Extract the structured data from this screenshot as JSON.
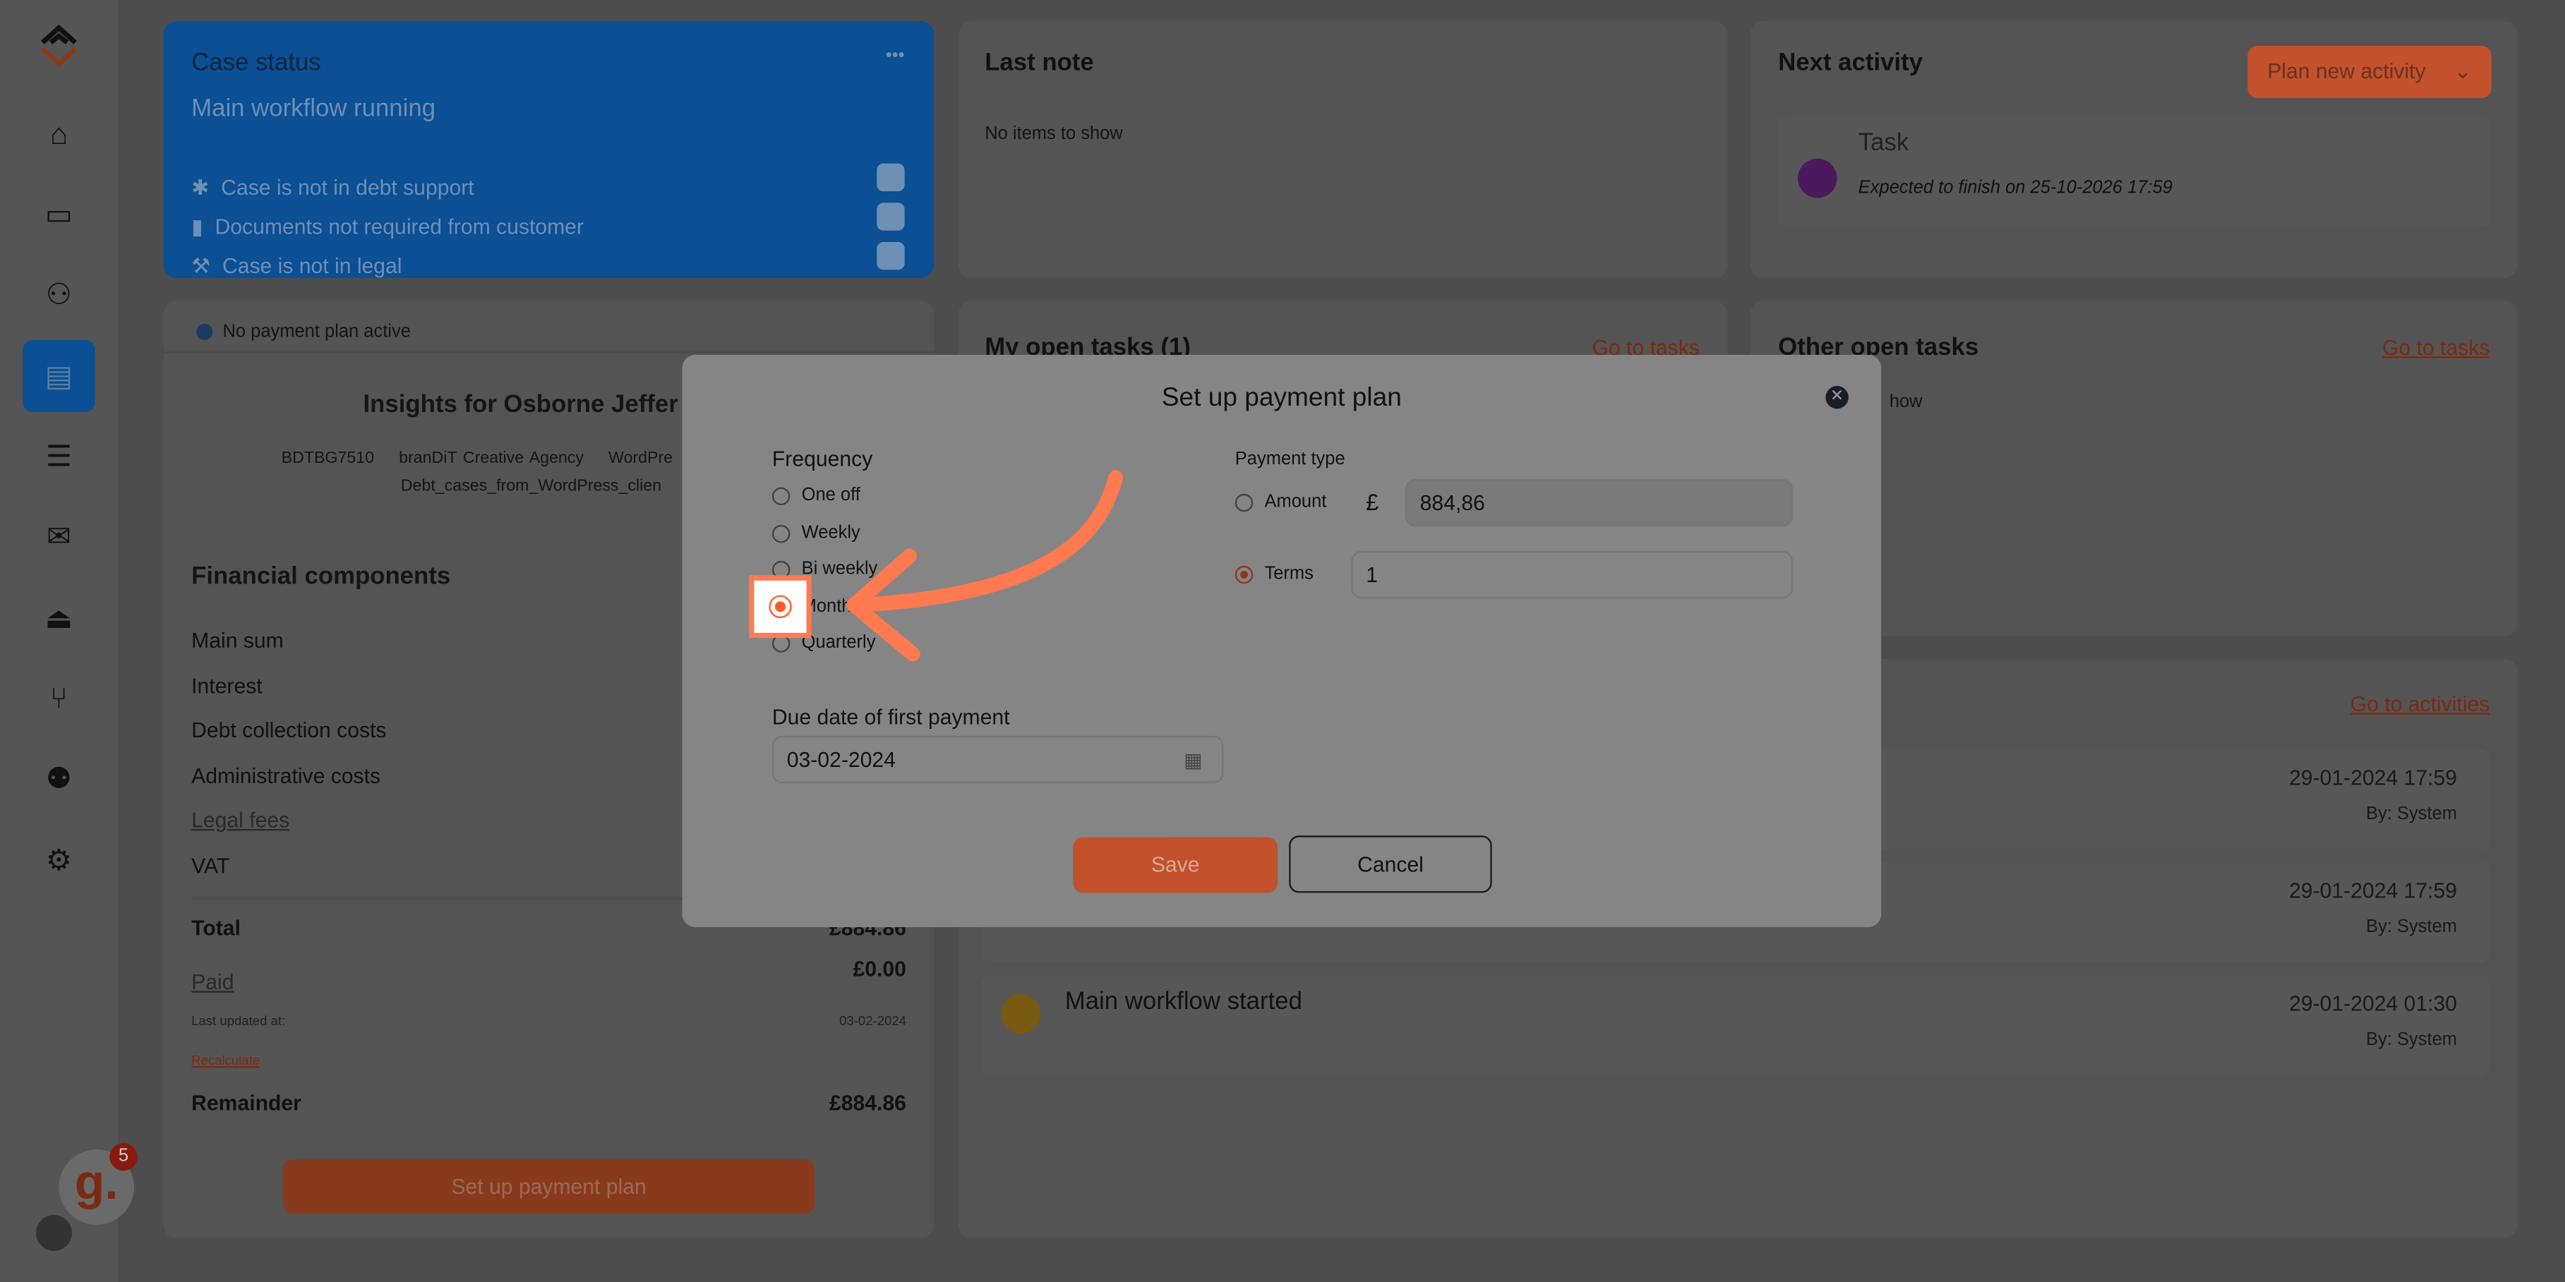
{
  "sidebar": {
    "items": [
      "home",
      "ticket",
      "users",
      "case-card",
      "database",
      "mail",
      "bank",
      "workflow",
      "team",
      "settings"
    ],
    "active": "case-card",
    "badge_count": "5"
  },
  "case_status": {
    "title": "Case status",
    "more": "•••",
    "state": "Main workflow running",
    "flags": [
      {
        "icon": "asterisk-icon",
        "label": "Case is not in debt support"
      },
      {
        "icon": "document-icon",
        "label": "Documents not required from customer"
      },
      {
        "icon": "gavel-icon",
        "label": "Case is not in legal"
      }
    ]
  },
  "last_note": {
    "title": "Last note",
    "empty": "No items to show"
  },
  "next_activity": {
    "title": "Next activity",
    "plan_button": "Plan new activity",
    "task_title": "Task",
    "task_sub": "Expected to finish on 25-10-2026 17:59"
  },
  "payment_info": {
    "notice": "No payment plan active",
    "insights_title": "Insights for Osborne Jeffer",
    "meta": [
      "BDTBG7510",
      "branDiT Creative Agency",
      "WordPre"
    ],
    "meta2": "Debt_cases_from_WordPress_clien"
  },
  "financial": {
    "title": "Financial components",
    "rows": [
      "Main sum",
      "Interest",
      "Debt collection costs",
      "Administrative costs",
      "Legal fees",
      "VAT"
    ],
    "total_label": "Total",
    "total_value": "£884.86",
    "paid_label": "Paid",
    "paid_value": "£0.00",
    "updated_label": "Last updated at:",
    "updated_value": "03-02-2024",
    "recalculate": "Recalculate",
    "remainder_label": "Remainder",
    "remainder_value": "£884.86",
    "setup_button": "Set up payment plan"
  },
  "my_tasks": {
    "title": "My open tasks (1)",
    "link": "Go to tasks"
  },
  "other_tasks": {
    "title": "Other open tasks",
    "link": "Go to tasks",
    "empty_fragment": "how"
  },
  "activities": {
    "link": "Go to activities",
    "items": [
      {
        "title": "",
        "date": "29-01-2024 17:59",
        "by": "By: System"
      },
      {
        "title": "",
        "date": "29-01-2024 17:59",
        "by": "By: System"
      },
      {
        "title": "Main workflow started",
        "date": "29-01-2024 01:30",
        "by": "By: System"
      }
    ]
  },
  "modal": {
    "title": "Set up payment plan",
    "frequency_label": "Frequency",
    "frequency_options": [
      "One off",
      "Weekly",
      "Bi weekly",
      "Monthly",
      "Quarterly"
    ],
    "frequency_selected": "Monthly",
    "payment_type_label": "Payment type",
    "amount_label": "Amount",
    "currency": "£",
    "amount_value": "884,86",
    "terms_label": "Terms",
    "terms_value": "1",
    "payment_type_selected": "Terms",
    "due_label": "Due date of first payment",
    "due_value": "03-02-2024",
    "save": "Save",
    "cancel": "Cancel"
  },
  "colors": {
    "accent": "#c2512c",
    "brand_blue": "#0b4f94",
    "highlight": "#ff7a50"
  }
}
